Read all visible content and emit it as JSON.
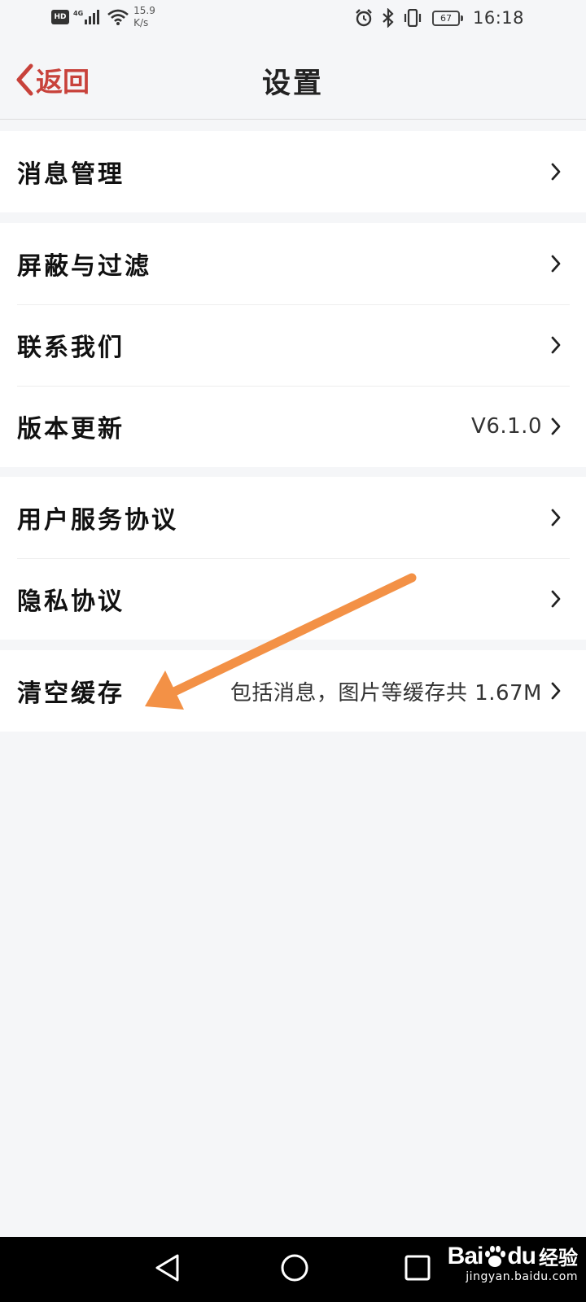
{
  "status_bar": {
    "hd": "HD",
    "network": "4G",
    "speed_value": "15.9",
    "speed_unit": "K/s",
    "battery": "67",
    "time": "16:18",
    "icons": [
      "signal-icon",
      "wifi-icon",
      "alarm-icon",
      "bluetooth-icon",
      "vibrate-icon",
      "battery-icon"
    ]
  },
  "header": {
    "back_label": "返回",
    "title": "设置"
  },
  "groups": [
    {
      "items": [
        {
          "label": "消息管理",
          "value": ""
        }
      ]
    },
    {
      "items": [
        {
          "label": "屏蔽与过滤",
          "value": ""
        },
        {
          "label": "联系我们",
          "value": ""
        },
        {
          "label": "版本更新",
          "value": "V6.1.0"
        }
      ]
    },
    {
      "items": [
        {
          "label": "用户服务协议",
          "value": ""
        },
        {
          "label": "隐私协议",
          "value": ""
        }
      ]
    },
    {
      "items": [
        {
          "label": "清空缓存",
          "value": "包括消息，图片等缓存共 1.67M"
        }
      ]
    }
  ],
  "colors": {
    "accent": "#c8423b",
    "background": "#f5f6f8",
    "annotation_arrow": "#f39146"
  },
  "watermark": {
    "brand_left": "Bai",
    "brand_right": "du",
    "brand_cn": "经验",
    "url": "jingyan.baidu.com"
  }
}
